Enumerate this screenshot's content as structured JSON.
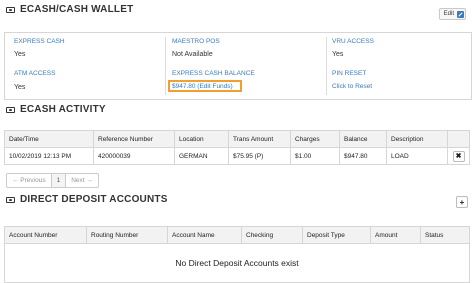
{
  "wallet": {
    "title": "ECASH/CASH WALLET",
    "edit_label": "Edit",
    "fields": {
      "express_cash_label": "EXPRESS CASH",
      "express_cash_value": "Yes",
      "maestro_pos_label": "MAESTRO POS",
      "maestro_pos_value": "Not Available",
      "vru_access_label": "VRU ACCESS",
      "vru_access_value": "Yes",
      "atm_access_label": "ATM ACCESS",
      "atm_access_value": "Yes",
      "express_balance_label": "EXPRESS CASH BALANCE",
      "express_balance_value": "$947.80 (Edit Funds)",
      "pin_reset_label": "PIN RESET",
      "pin_reset_value": "Click to Reset"
    }
  },
  "activity": {
    "title": "ECASH ACTIVITY",
    "columns": [
      "Date/Time",
      "Reference Number",
      "Location",
      "Trans Amount",
      "Charges",
      "Balance",
      "Description"
    ],
    "rows": [
      {
        "date": "10/02/2019 12:13 PM",
        "ref": "420000039",
        "location": "GERMAN",
        "amount": "$75.95 (P)",
        "charges": "$1.00",
        "balance": "$947.80",
        "description": "LOAD",
        "delete": "✖"
      }
    ],
    "pager": {
      "prev": "← Previous",
      "page": "1",
      "next": "Next →"
    }
  },
  "deposits": {
    "title": "DIRECT DEPOSIT ACCOUNTS",
    "add_label": "+",
    "columns": [
      "Account Number",
      "Routing Number",
      "Account Name",
      "Checking",
      "Deposit Type",
      "Amount",
      "Status"
    ],
    "empty_message": "No Direct Deposit Accounts exist"
  },
  "colors": {
    "link": "#3a7bbf",
    "highlight": "#f0a030",
    "header_bg": "#f2f2f2"
  }
}
